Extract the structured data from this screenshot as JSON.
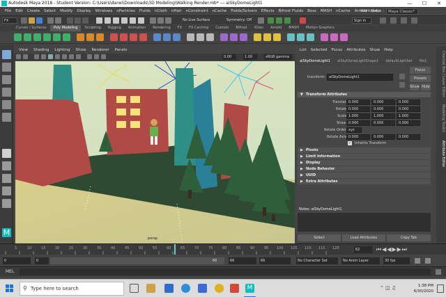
{
  "window": {
    "title": "Autodesk Maya 2018 - Student Version: C:\\Users\\darwi\\Downloads\\3D Modeling\\Walking Render.mb* --- aiSkyDomeLight1",
    "min_icon": "minimize-icon",
    "max_icon": "maximize-icon",
    "close_icon": "close-icon"
  },
  "menubar": {
    "items": [
      "File",
      "Edit",
      "Create",
      "Select",
      "Modify",
      "Display",
      "Windows",
      "nParticles",
      "Fluids",
      "nCloth",
      "nHair",
      "nConstraint",
      "nCache",
      "Fields/Solvers",
      "Effects",
      "Bifrost Fluids",
      "Boss",
      "MASH",
      "nCache",
      "Arnold",
      "Help"
    ],
    "workspace_label": "Workspace :",
    "workspace_value": "Maya Classic*"
  },
  "statusline": {
    "mode": "FX",
    "live_surface": "No Live Surface",
    "symmetry": "Symmetry: Off",
    "sign_in": "Sign in"
  },
  "shelf": {
    "tabs": [
      "Curves / Surfaces",
      "Poly Modeling",
      "Sculpting",
      "Rigging",
      "Animation",
      "Rendering",
      "FX",
      "FX Caching",
      "Custom",
      "Bifrost",
      "XGen",
      "Arnold",
      "MASH",
      "Motion Graphics"
    ],
    "active_tab": "Poly Modeling"
  },
  "viewport": {
    "menu": [
      "View",
      "Shading",
      "Lighting",
      "Show",
      "Renderer",
      "Panels"
    ],
    "field1": "0.00",
    "field2": "1.00",
    "color_space": "sRGB gamma",
    "camera_label": "persp"
  },
  "channelbox": {
    "menu": [
      "List",
      "Selected",
      "Focus",
      "Attributes",
      "Show",
      "Help"
    ],
    "tabs": [
      "aiSkyDomeLight1",
      "aiSkyDomeLightShape1",
      "defaultLightSet",
      "file1"
    ],
    "transform_label": "transform:",
    "transform_value": "aiSkyDomeLight1",
    "focus_btn": "Focus",
    "presets_btn": "Presets",
    "show_btn": "Show",
    "hide_btn": "Hide",
    "transform_attrs_header": "Transform Attributes",
    "attrs": [
      {
        "label": "Translate",
        "x": "0.000",
        "y": "0.000",
        "z": "0.000"
      },
      {
        "label": "Rotate",
        "x": "0.000",
        "y": "0.000",
        "z": "0.000"
      },
      {
        "label": "Scale",
        "x": "1.000",
        "y": "1.000",
        "z": "1.000"
      },
      {
        "label": "Shear",
        "x": "0.000",
        "y": "0.000",
        "z": "0.000"
      }
    ],
    "rotate_order_label": "Rotate Order",
    "rotate_order_value": "xyz",
    "rotate_axis_label": "Rotate Axis",
    "rotate_axis": [
      "0.000",
      "0.000",
      "0.000"
    ],
    "inherits_label": "Inherits Transform",
    "sections": [
      "Pivots",
      "Limit Information",
      "Display",
      "Node Behavior",
      "UUID",
      "Extra Attributes"
    ],
    "notes_label": "Notes: aiSkyDomeLight1",
    "select_btn": "Select",
    "load_btn": "Load Attributes",
    "copy_btn": "Copy Tab"
  },
  "sidetabs": [
    "Channel Box / Layer Editor",
    "Modeling Toolkit",
    "Attribute Editor"
  ],
  "timeline": {
    "ticks": [
      "5",
      "10",
      "15",
      "20",
      "25",
      "30",
      "35",
      "40",
      "45",
      "50",
      "55",
      "60",
      "65",
      "70",
      "75",
      "80",
      "85",
      "90",
      "95",
      "100",
      "105",
      "110",
      "115",
      "120"
    ],
    "current_frame": "62"
  },
  "range": {
    "start": "0",
    "inner_start": "0",
    "inner_end": "66",
    "end_a": "66",
    "end_b": "66",
    "char_set": "No Character Set",
    "anim_layer": "No Anim Layer",
    "fps": "30 fps"
  },
  "mel": {
    "label": "MEL"
  },
  "taskbar": {
    "search": "Type here to search",
    "time": "1:38 PM",
    "date": "6/30/2020"
  },
  "colors": {
    "viewport_sky": "#d9e3c0",
    "ground": "#2f4a32",
    "brick": "#b04a47",
    "teal": "#2e8f86",
    "accent_cyan": "#1ab0b0"
  }
}
